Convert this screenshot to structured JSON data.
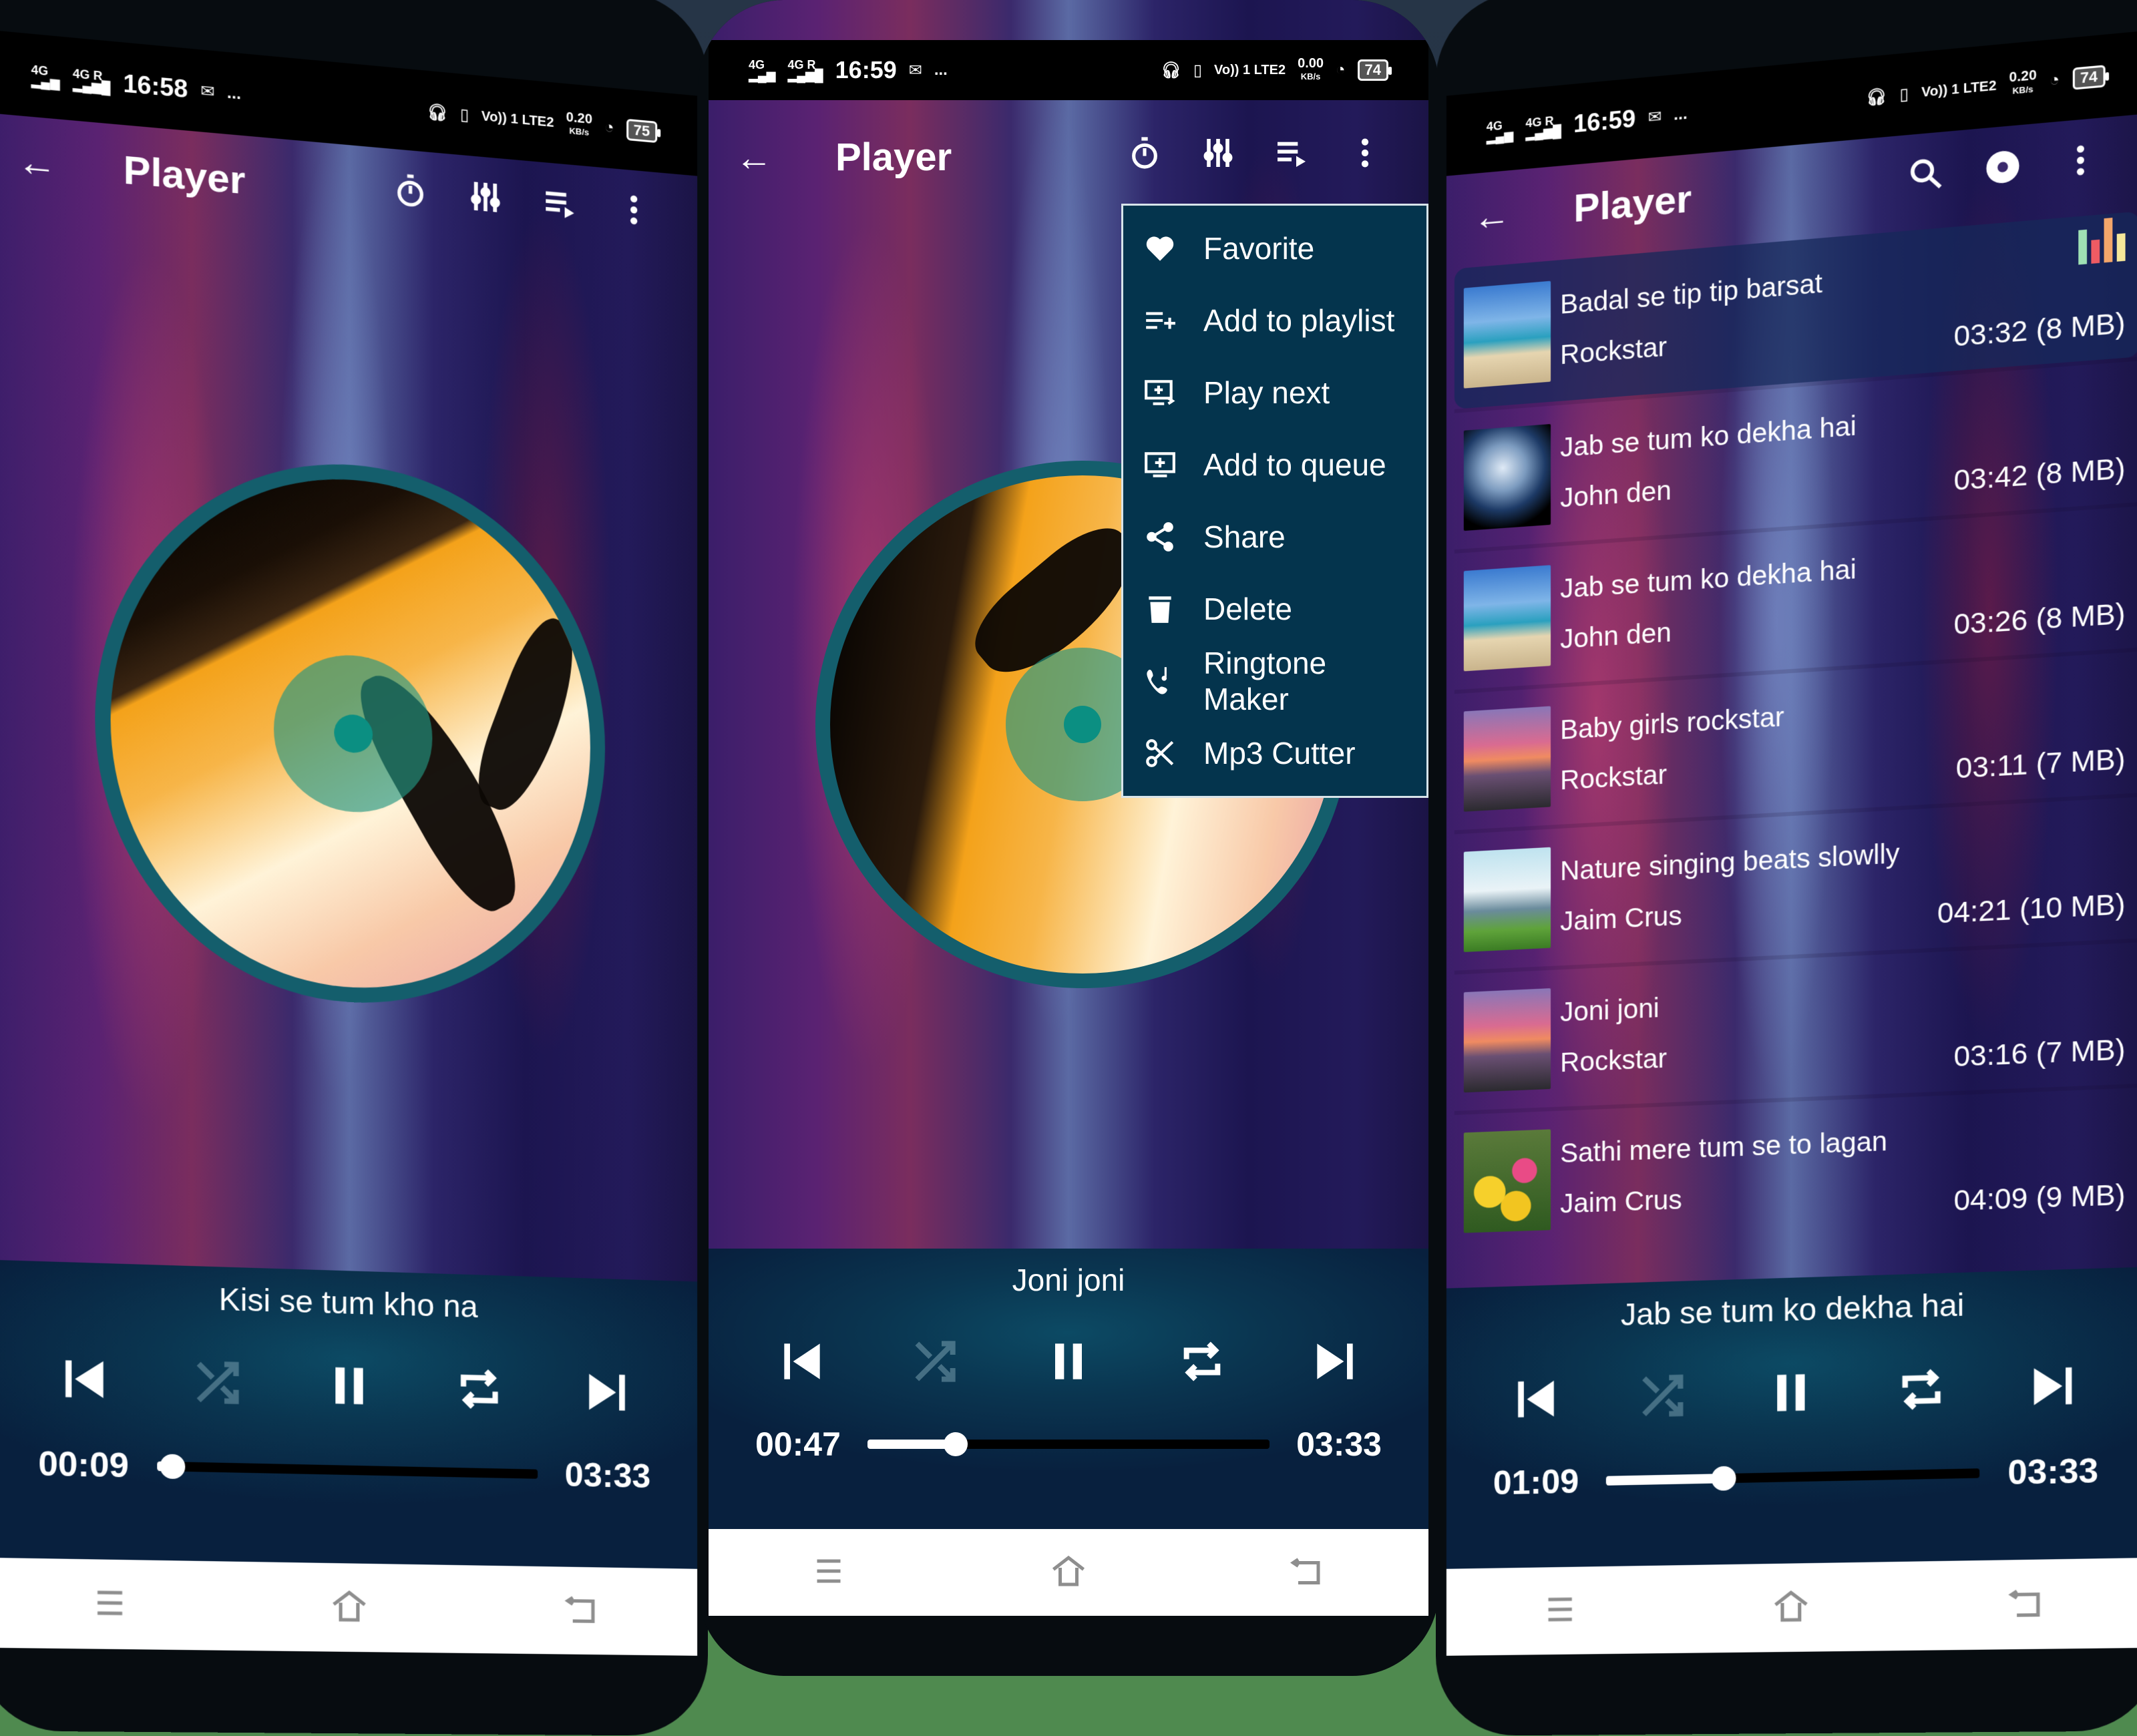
{
  "colors": {
    "menu_bg": "#04344d",
    "player_panel": "#0a3550",
    "disc_ring": "#145e6c",
    "background_top": "#243245",
    "background_bottom": "#4f8a4f"
  },
  "phones": [
    {
      "status": {
        "net1": "4G",
        "net2": "4G R",
        "time": "16:58",
        "volte": "Vo)) 1 LTE2",
        "speed": "0.20",
        "speed_unit": "KB/s",
        "battery": "75",
        "more": "..."
      },
      "toolbar": {
        "title": "Player",
        "icons": [
          "back-arrow-icon",
          "sleep-timer-icon",
          "equalizer-icon",
          "queue-icon",
          "more-vert-icon"
        ]
      },
      "now_playing": "Kisi se tum kho na",
      "elapsed": "00:09",
      "duration": "03:33",
      "progress": 0.04
    },
    {
      "status": {
        "net1": "4G",
        "net2": "4G R",
        "time": "16:59",
        "volte": "Vo)) 1 LTE2",
        "speed": "0.00",
        "speed_unit": "KB/s",
        "battery": "74",
        "more": "..."
      },
      "toolbar": {
        "title": "Player",
        "icons": [
          "back-arrow-icon",
          "sleep-timer-icon",
          "equalizer-icon",
          "queue-icon",
          "more-vert-icon"
        ]
      },
      "menu": [
        {
          "icon": "heart-icon",
          "label": "Favorite"
        },
        {
          "icon": "playlist-add-icon",
          "label": "Add to playlist"
        },
        {
          "icon": "play-next-icon",
          "label": "Play next"
        },
        {
          "icon": "add-to-queue-icon",
          "label": "Add to queue"
        },
        {
          "icon": "share-icon",
          "label": "Share"
        },
        {
          "icon": "trash-icon",
          "label": "Delete"
        },
        {
          "icon": "ringtone-icon",
          "label": "Ringtone Maker"
        },
        {
          "icon": "scissors-icon",
          "label": "Mp3 Cutter"
        }
      ],
      "now_playing": "Joni joni",
      "elapsed": "00:47",
      "duration": "03:33",
      "progress": 0.22
    },
    {
      "status": {
        "net1": "4G",
        "net2": "4G R",
        "time": "16:59",
        "volte": "Vo)) 1 LTE2",
        "speed": "0.20",
        "speed_unit": "KB/s",
        "battery": "74",
        "more": "..."
      },
      "toolbar": {
        "title": "Player",
        "icons": [
          "back-arrow-icon",
          "search-icon",
          "disc-icon",
          "more-vert-icon"
        ]
      },
      "songs": [
        {
          "title": "Badal se tip tip barsat",
          "artist": "Rockstar",
          "duration": "03:32",
          "size": "(8 MB)",
          "art": "beach",
          "playing": true
        },
        {
          "title": "Jab se tum ko dekha hai",
          "artist": "John den",
          "duration": "03:42",
          "size": "(8 MB)",
          "art": "moon",
          "playing": false
        },
        {
          "title": "Jab se tum ko dekha hai",
          "artist": "John den",
          "duration": "03:26",
          "size": "(8 MB)",
          "art": "beach",
          "playing": false
        },
        {
          "title": "Baby girls rockstar",
          "artist": "Rockstar",
          "duration": "03:11",
          "size": "(7 MB)",
          "art": "sunset",
          "playing": false
        },
        {
          "title": "Nature singing beats slowlly",
          "artist": "Jaim Crus",
          "duration": "04:21",
          "size": "(10 MB)",
          "art": "bench",
          "playing": false
        },
        {
          "title": "Joni joni",
          "artist": "Rockstar",
          "duration": "03:16",
          "size": "(7 MB)",
          "art": "sunset",
          "playing": false
        },
        {
          "title": "Sathi mere tum se to lagan",
          "artist": "Jaim Crus",
          "duration": "04:09",
          "size": "(9 MB)",
          "art": "flowers",
          "playing": false
        }
      ],
      "eq_colors": [
        "#9fe0b4",
        "#ef5b63",
        "#f4a66a",
        "#f6e79a"
      ],
      "now_playing": "Jab se tum ko dekha hai",
      "elapsed": "01:09",
      "duration": "03:33",
      "progress": 0.32
    }
  ],
  "controls": [
    "skip-previous-icon",
    "shuffle-icon",
    "pause-icon",
    "repeat-icon",
    "skip-next-icon"
  ],
  "navbar": [
    "menu-lines-icon",
    "home-icon",
    "back-icon"
  ]
}
